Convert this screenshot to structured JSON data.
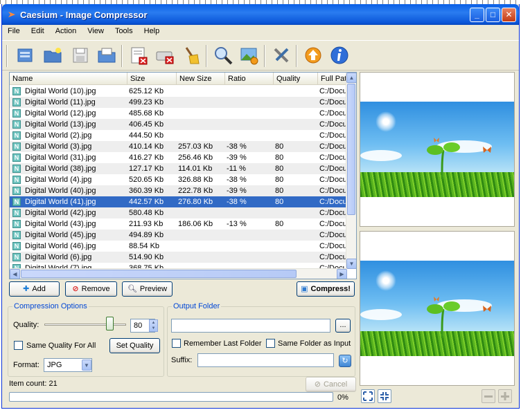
{
  "window": {
    "title": "Caesium - Image Compressor",
    "minimize": "_",
    "maximize": "□",
    "close": "✕"
  },
  "menu": [
    "File",
    "Edit",
    "Action",
    "View",
    "Tools",
    "Help"
  ],
  "toolbar_icons": [
    "open-file-icon",
    "open-folder-icon",
    "save-list-icon",
    "import-icon",
    "clear-list-icon",
    "remove-item-icon",
    "clean-icon",
    "preview-zoom-icon",
    "image-settings-icon",
    "tools-icon",
    "update-icon",
    "info-icon"
  ],
  "table": {
    "columns": [
      "Name",
      "Size",
      "New Size",
      "Ratio",
      "Quality",
      "Full Pat"
    ],
    "rows": [
      {
        "name": "Digital World (10).jpg",
        "size": "625.12 Kb",
        "new_size": "",
        "ratio": "",
        "quality": "",
        "path": "C:/Docu"
      },
      {
        "name": "Digital World (11).jpg",
        "size": "499.23 Kb",
        "new_size": "",
        "ratio": "",
        "quality": "",
        "path": "C:/Docu"
      },
      {
        "name": "Digital World (12).jpg",
        "size": "485.68 Kb",
        "new_size": "",
        "ratio": "",
        "quality": "",
        "path": "C:/Docu"
      },
      {
        "name": "Digital World (13).jpg",
        "size": "406.45 Kb",
        "new_size": "",
        "ratio": "",
        "quality": "",
        "path": "C:/Docu"
      },
      {
        "name": "Digital World (2).jpg",
        "size": "444.50 Kb",
        "new_size": "",
        "ratio": "",
        "quality": "",
        "path": "C:/Docu"
      },
      {
        "name": "Digital World (3).jpg",
        "size": "410.14 Kb",
        "new_size": "257.03 Kb",
        "ratio": "-38 %",
        "quality": "80",
        "path": "C:/Docu"
      },
      {
        "name": "Digital World (31).jpg",
        "size": "416.27 Kb",
        "new_size": "256.46 Kb",
        "ratio": "-39 %",
        "quality": "80",
        "path": "C:/Docu"
      },
      {
        "name": "Digital World (38).jpg",
        "size": "127.17 Kb",
        "new_size": "114.01 Kb",
        "ratio": "-11 %",
        "quality": "80",
        "path": "C:/Docu"
      },
      {
        "name": "Digital World (4).jpg",
        "size": "520.65 Kb",
        "new_size": "326.88 Kb",
        "ratio": "-38 %",
        "quality": "80",
        "path": "C:/Docu"
      },
      {
        "name": "Digital World (40).jpg",
        "size": "360.39 Kb",
        "new_size": "222.78 Kb",
        "ratio": "-39 %",
        "quality": "80",
        "path": "C:/Docu"
      },
      {
        "name": "Digital World (41).jpg",
        "size": "442.57 Kb",
        "new_size": "276.80 Kb",
        "ratio": "-38 %",
        "quality": "80",
        "path": "C:/Docu"
      },
      {
        "name": "Digital World (42).jpg",
        "size": "580.48 Kb",
        "new_size": "",
        "ratio": "",
        "quality": "",
        "path": "C:/Docu"
      },
      {
        "name": "Digital World (43).jpg",
        "size": "211.93 Kb",
        "new_size": "186.06 Kb",
        "ratio": "-13 %",
        "quality": "80",
        "path": "C:/Docu"
      },
      {
        "name": "Digital World (45).jpg",
        "size": "494.89 Kb",
        "new_size": "",
        "ratio": "",
        "quality": "",
        "path": "C:/Docu"
      },
      {
        "name": "Digital World (46).jpg",
        "size": "88.54 Kb",
        "new_size": "",
        "ratio": "",
        "quality": "",
        "path": "C:/Docu"
      },
      {
        "name": "Digital World (6).jpg",
        "size": "514.90 Kb",
        "new_size": "",
        "ratio": "",
        "quality": "",
        "path": "C:/Docu"
      },
      {
        "name": "Digital World (7).jpg",
        "size": "368.75 Kb",
        "new_size": "",
        "ratio": "",
        "quality": "",
        "path": "C:/Docu"
      }
    ],
    "selected_row": 10,
    "row_icon_letter": "N"
  },
  "buttons": {
    "add": "Add",
    "remove": "Remove",
    "preview": "Preview",
    "compress": "Compress!"
  },
  "compression": {
    "group_label": "Compression Options",
    "quality_label": "Quality:",
    "quality_value": "80",
    "quality_fraction": 0.8,
    "same_quality_label": "Same Quality For All",
    "set_quality_button": "Set Quality",
    "format_label": "Format:",
    "format_value": "JPG"
  },
  "output": {
    "group_label": "Output Folder",
    "folder_value": "",
    "browse_button": "...",
    "remember_label": "Remember Last Folder",
    "same_folder_label": "Same Folder as Input",
    "suffix_label": "Suffix:",
    "suffix_value": ""
  },
  "status": {
    "item_count": "Item count: 21",
    "cancel_button": "Cancel",
    "progress_text": "0%",
    "progress_fraction": 0
  },
  "colors": {
    "accent": "#316ac5",
    "titlebar": "#0a5fe6",
    "group_label": "#0046d5"
  }
}
